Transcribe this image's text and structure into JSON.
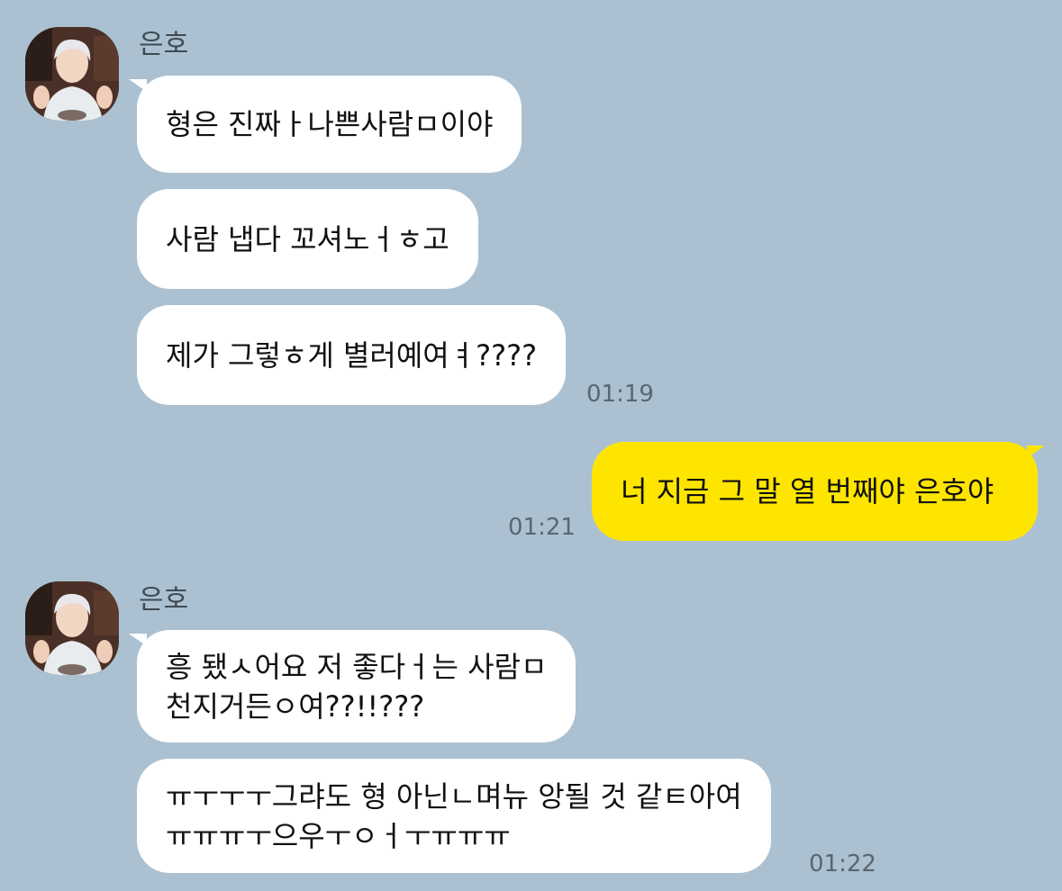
{
  "chat": {
    "sender_name": "은호",
    "groups": [
      {
        "sender": "은호",
        "messages": [
          "형은 진짜ㅏ나쁜사람ㅁ이야",
          "사람 냅다 꼬셔노ㅓㅎ고",
          "제가 그렇ㅎ게 별러예여ㅕ????"
        ],
        "time": "01:19"
      },
      {
        "sender": "me",
        "messages": [
          "너 지금 그 말 열 번째야 은호야"
        ],
        "time": "01:21"
      },
      {
        "sender": "은호",
        "messages": [
          "흥 됐ㅅ어요 저 좋다ㅓ는 사람ㅁ\n천지거든ㅇ여??!!???",
          "ㅠㅜㅜㅜ그랴도 형 아닌ㄴ며뉴 앙될 것 같ㅌ아여\nㅠㅠㅠㅜ으우ㅜㅇㅓㅜㅠㅠㅠ"
        ],
        "time": "01:22"
      }
    ]
  },
  "colors": {
    "background": "#abc1d1",
    "incoming_bubble": "#ffffff",
    "outgoing_bubble": "#fee500"
  },
  "icons": {
    "avatar": "profile-avatar-illustration"
  }
}
